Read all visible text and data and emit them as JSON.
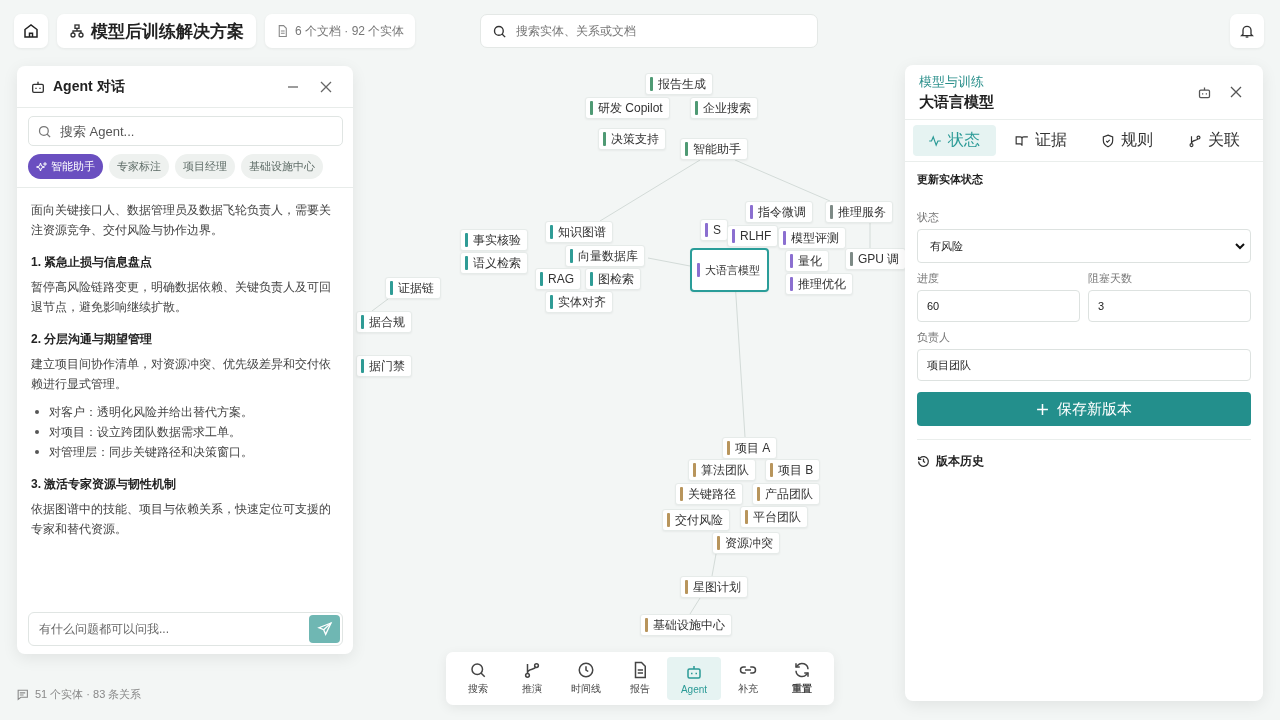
{
  "topbar": {
    "project_title": "模型后训练解决方案",
    "doc_summary": "6 个文档 · 92 个实体",
    "search": {
      "placeholder": "搜索实体、关系或文档"
    }
  },
  "agent_panel": {
    "title": "Agent 对话",
    "search": {
      "placeholder": "搜索 Agent..."
    },
    "agents": [
      {
        "label": "智能助手",
        "selected": true
      },
      {
        "label": "专家标注",
        "selected": false
      },
      {
        "label": "项目经理",
        "selected": false
      },
      {
        "label": "基础设施中心",
        "selected": false
      }
    ],
    "message": [
      {
        "kind": "paragraph",
        "text": "面向关键接口人、数据管理员及数据飞轮负责人，需要关注资源竞争、交付风险与协作边界。"
      },
      {
        "kind": "heading",
        "text": "1. 紧急止损与信息盘点"
      },
      {
        "kind": "paragraph",
        "text": "暂停高风险链路变更，明确数据依赖、关键负责人及可回退节点，避免影响继续扩散。"
      },
      {
        "kind": "heading",
        "text": "2. 分层沟通与期望管理"
      },
      {
        "kind": "paragraph",
        "text": "建立项目间协作清单，对资源冲突、优先级差异和交付依赖进行显式管理。"
      },
      {
        "kind": "list",
        "items": [
          "对客户：透明化风险并给出替代方案。",
          "对项目：设立跨团队数据需求工单。",
          "对管理层：同步关键路径和决策窗口。"
        ]
      },
      {
        "kind": "heading",
        "text": "3. 激活专家资源与韧性机制"
      },
      {
        "kind": "paragraph",
        "text": "依据图谱中的技能、项目与依赖关系，快速定位可支援的专家和替代资源。"
      }
    ],
    "input": {
      "placeholder": "有什么问题都可以问我..."
    }
  },
  "graph": {
    "nodes": [
      {
        "label": "报告生成",
        "color": "#4f9a74",
        "selected": false
      },
      {
        "label": "研发 Copilot",
        "color": "#4f9a74",
        "selected": false
      },
      {
        "label": "企业搜索",
        "color": "#4f9a74",
        "selected": false
      },
      {
        "label": "决策支持",
        "color": "#4f9a74",
        "selected": false
      },
      {
        "label": "智能助手",
        "color": "#4f9a74",
        "selected": false
      },
      {
        "label": "知识图谱",
        "color": "#2f9c96",
        "selected": false
      },
      {
        "label": "事实核验",
        "color": "#2f9c96",
        "selected": false
      },
      {
        "label": "语义检索",
        "color": "#2f9c96",
        "selected": false
      },
      {
        "label": "向量数据库",
        "color": "#2f9c96",
        "selected": false
      },
      {
        "label": "RAG",
        "color": "#2f9c96",
        "selected": false
      },
      {
        "label": "图检索",
        "color": "#2f9c96",
        "selected": false
      },
      {
        "label": "实体对齐",
        "color": "#2f9c96",
        "selected": false
      },
      {
        "label": "证据链",
        "color": "#2f9c96",
        "selected": false
      },
      {
        "label": "据合规",
        "color": "#2f9c96",
        "selected": false
      },
      {
        "label": "据门禁",
        "color": "#2f9c96",
        "selected": false
      },
      {
        "label": "推理服务",
        "color": "#7d8a86",
        "selected": false
      },
      {
        "label": "指令微调",
        "color": "#8b6fd0",
        "selected": false
      },
      {
        "label": "S",
        "color": "#8b6fd0",
        "selected": false
      },
      {
        "label": "RLHF",
        "color": "#8b6fd0",
        "selected": false
      },
      {
        "label": "模型评测",
        "color": "#8b6fd0",
        "selected": false
      },
      {
        "label": "量化",
        "color": "#8b6fd0",
        "selected": false
      },
      {
        "label": "GPU 调",
        "color": "#7d8a86",
        "selected": false
      },
      {
        "label": "大语言模型",
        "color": "#8b6fd0",
        "selected": true
      },
      {
        "label": "推理优化",
        "color": "#8b6fd0",
        "selected": false
      },
      {
        "label": "项目 A",
        "color": "#b8955c",
        "selected": false
      },
      {
        "label": "算法团队",
        "color": "#b8955c",
        "selected": false
      },
      {
        "label": "项目 B",
        "color": "#b8955c",
        "selected": false
      },
      {
        "label": "关键路径",
        "color": "#b8955c",
        "selected": false
      },
      {
        "label": "产品团队",
        "color": "#b8955c",
        "selected": false
      },
      {
        "label": "交付风险",
        "color": "#b8955c",
        "selected": false
      },
      {
        "label": "平台团队",
        "color": "#b8955c",
        "selected": false
      },
      {
        "label": "资源冲突",
        "color": "#b8955c",
        "selected": false
      },
      {
        "label": "星图计划",
        "color": "#b8955c",
        "selected": false
      },
      {
        "label": "基础设施中心",
        "color": "#b8955c",
        "selected": false
      }
    ]
  },
  "status": "51 个实体 · 83 条关系",
  "toolbar": [
    {
      "label": "搜索",
      "selected": false
    },
    {
      "label": "推演",
      "selected": false
    },
    {
      "label": "时间线",
      "selected": false
    },
    {
      "label": "报告",
      "selected": false
    },
    {
      "label": "Agent",
      "selected": true
    },
    {
      "label": "补充",
      "selected": false
    },
    {
      "label": "重置",
      "selected": false
    }
  ],
  "detail_panel": {
    "category": "模型与训练",
    "title": "大语言模型",
    "tabs": [
      {
        "label": "状态",
        "selected": true
      },
      {
        "label": "证据",
        "selected": false
      },
      {
        "label": "规则",
        "selected": false
      },
      {
        "label": "关联",
        "selected": false
      }
    ],
    "section_title": "更新实体状态",
    "status_field": {
      "label": "状态",
      "value": "有风险"
    },
    "progress_field": {
      "label": "进度",
      "value": "60"
    },
    "blocked_days_field": {
      "label": "阻塞天数",
      "value": "3"
    },
    "owner_field": {
      "label": "负责人",
      "value": "项目团队"
    },
    "save_button": "保存新版本",
    "history_title": "版本历史"
  }
}
